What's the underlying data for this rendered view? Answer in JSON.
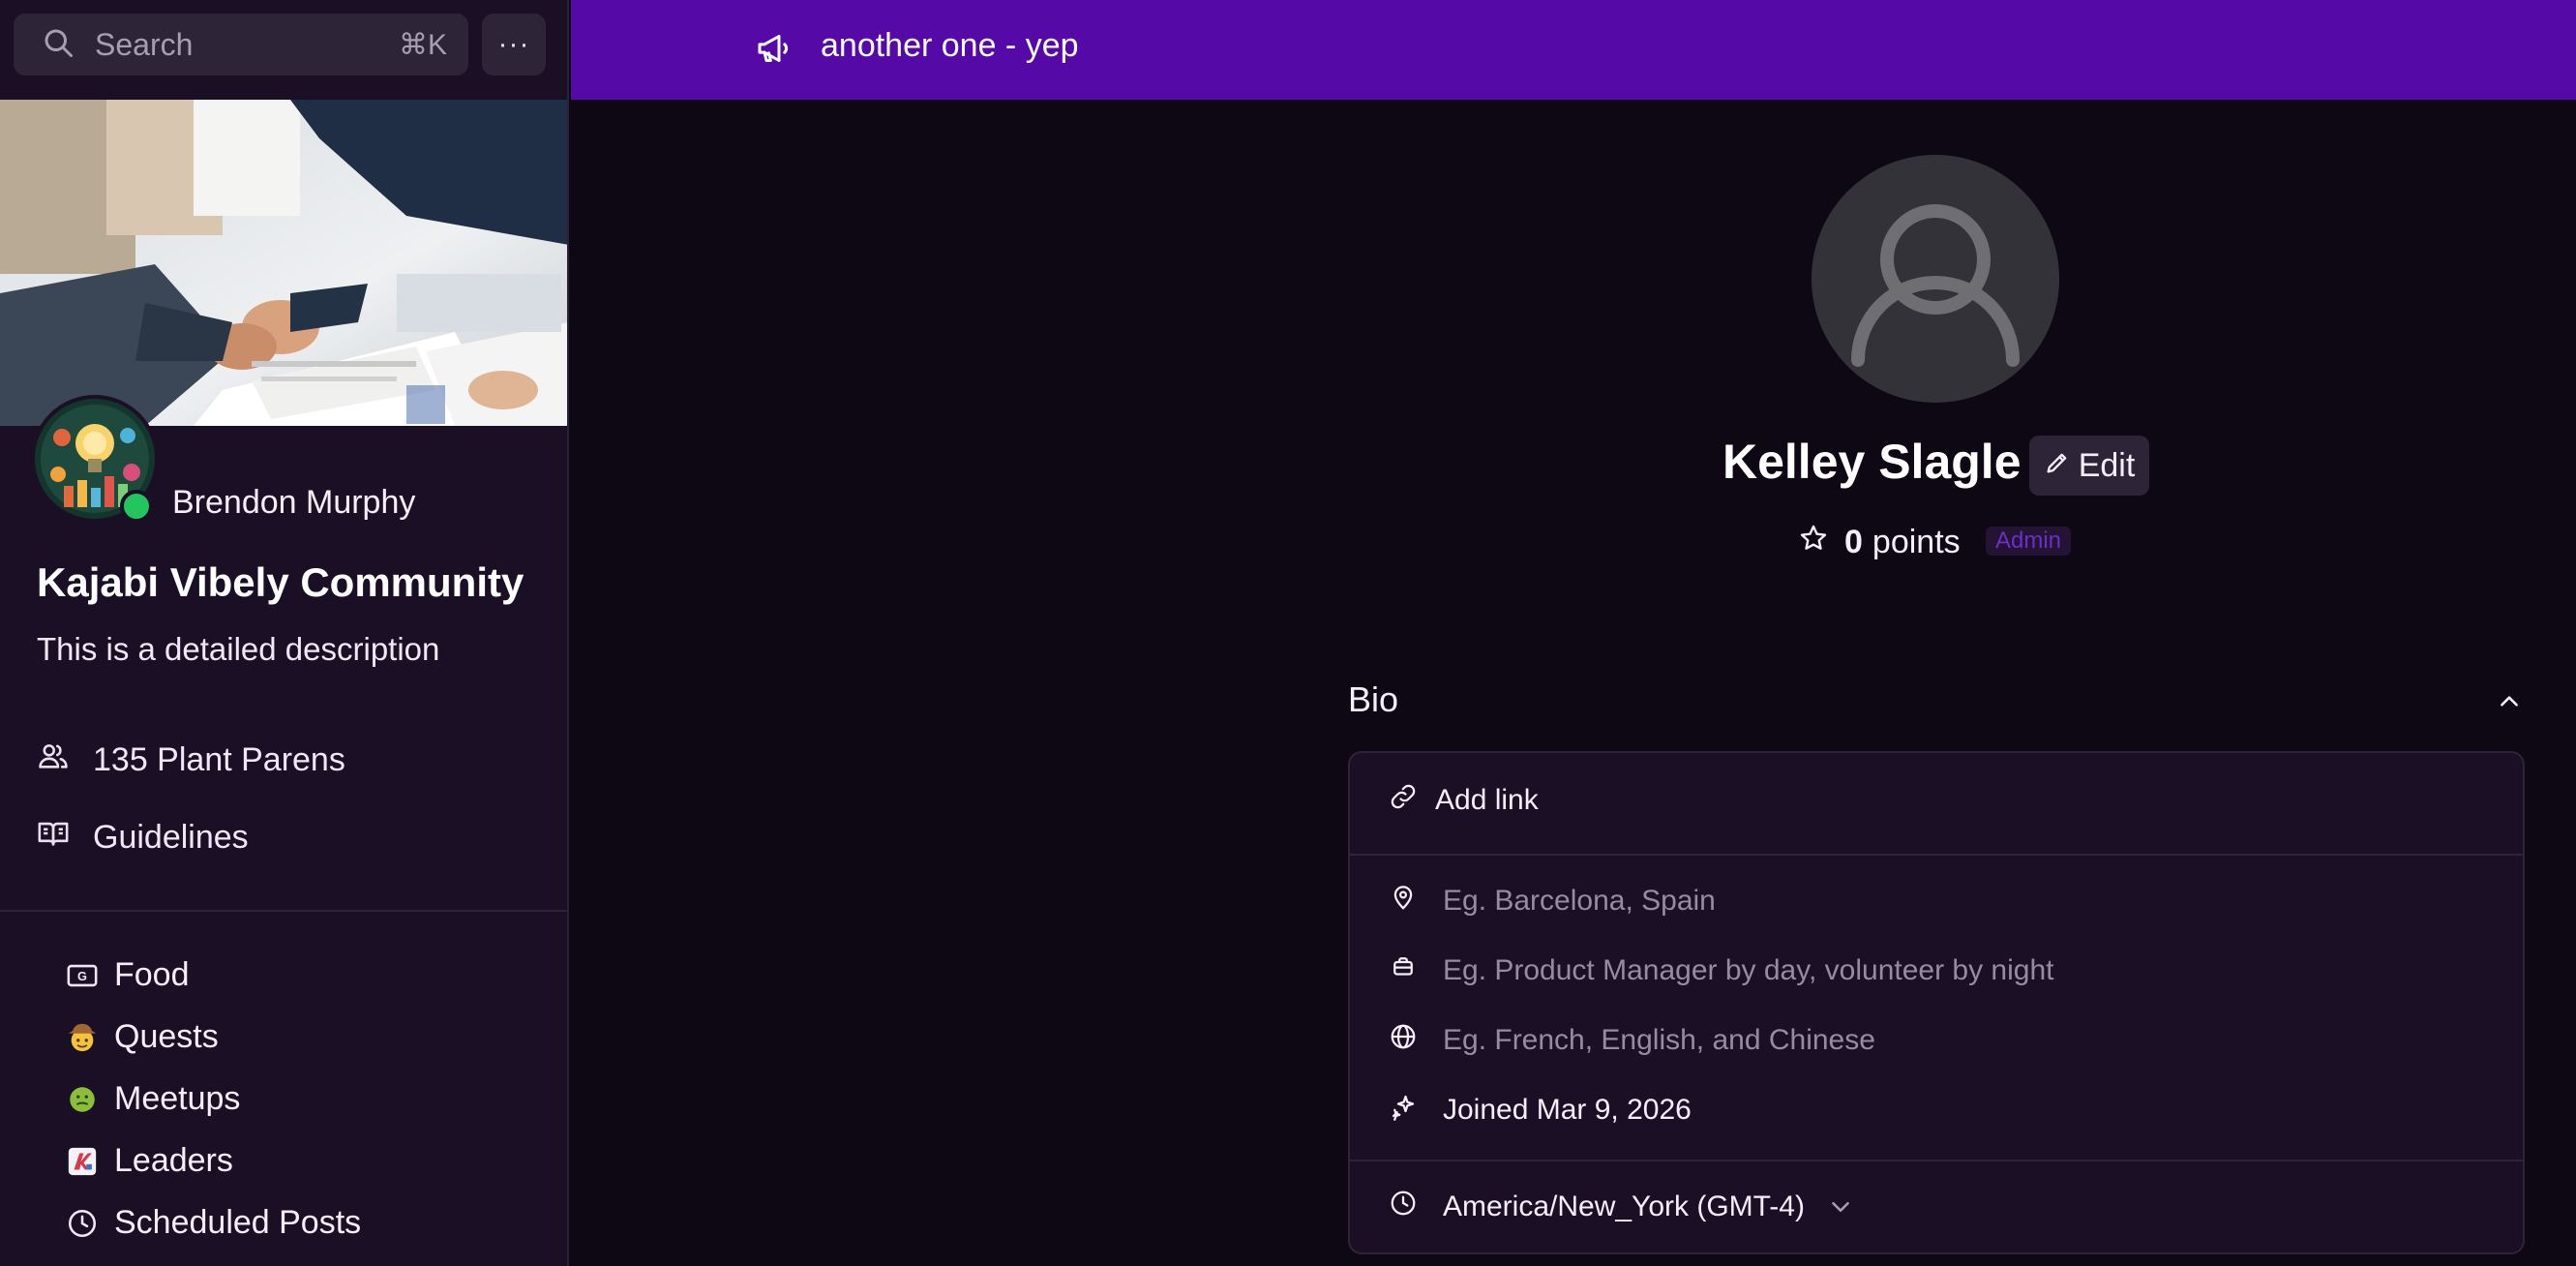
{
  "search": {
    "placeholder": "Search",
    "shortcut": "⌘K"
  },
  "more_menu": {
    "label": "···"
  },
  "sidebar": {
    "owner_name": "Brendon Murphy",
    "community_title": "Kajabi Vibely Community",
    "community_description": "This is a detailed description",
    "members": "135 Plant Parens",
    "guidelines": "Guidelines",
    "nav": [
      {
        "label": "Food",
        "icon": "g-badge-icon"
      },
      {
        "label": "Quests",
        "icon": "cowboy-emoji-icon"
      },
      {
        "label": "Meetups",
        "icon": "nauseated-emoji-icon"
      },
      {
        "label": "Leaders",
        "icon": "leader-image-icon"
      },
      {
        "label": "Scheduled Posts",
        "icon": "clock-icon"
      }
    ]
  },
  "banner": {
    "text": "another one - yep",
    "icon": "megaphone-icon"
  },
  "profile": {
    "name": "Kelley Slagle",
    "edit_label": "Edit",
    "points_value": "0",
    "points_label": "points",
    "role_badge": "Admin"
  },
  "bio": {
    "title": "Bio",
    "add_link": "Add link",
    "location_placeholder": "Eg. Barcelona, Spain",
    "job_placeholder": "Eg. Product Manager by day, volunteer by night",
    "languages_placeholder": "Eg. French, English, and Chinese",
    "joined": "Joined Mar 9, 2026",
    "timezone": "America/New_York (GMT-4)"
  },
  "colors": {
    "banner": "#5509a6",
    "sidebar_bg": "#1b0f26",
    "main_bg": "#0d0814",
    "online": "#22c55e",
    "admin_badge_text": "#6a2fc4"
  }
}
